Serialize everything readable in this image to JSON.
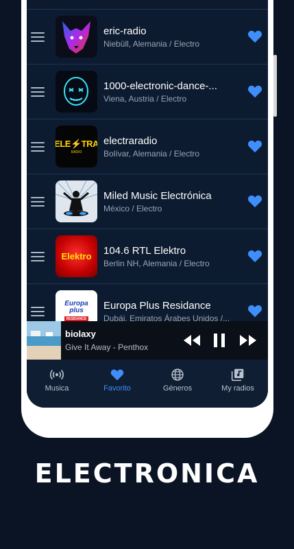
{
  "stations": [
    {
      "name": "eric-radio",
      "location": "Niebüll, Alemania / Electro",
      "logo_icon": "neon-wolf-logo"
    },
    {
      "name": "1000-electronic-dance-...",
      "location": "Viena, Austria / Electro",
      "logo_icon": "neon-mask-logo"
    },
    {
      "name": "electraradio",
      "location": "Bolívar, Alemania / Electro",
      "logo_icon": "electra-logo",
      "logo_text": "ELE⚡TRA",
      "logo_subtext": "RADIO"
    },
    {
      "name": "Miled Music Electrónica",
      "location": "México / Electro",
      "logo_icon": "dj-silhouette-logo"
    },
    {
      "name": "104.6 RTL Elektro",
      "location": "Berlin NH, Alemania / Electro",
      "logo_icon": "elektro-logo",
      "logo_text": "Elektro"
    },
    {
      "name": "Europa Plus Residance",
      "location": "Dubái, Emiratos Árabes Unidos /...",
      "logo_icon": "europa-plus-logo",
      "logo_text": "Europa plus",
      "logo_subtext": "RESIDANCE"
    }
  ],
  "player": {
    "title": "biolaxy",
    "subtitle": "Give It Away - Penthox"
  },
  "nav": [
    {
      "label": "Musica",
      "icon": "radio-waves-icon",
      "active": false
    },
    {
      "label": "Favorito",
      "icon": "heart-icon",
      "active": true
    },
    {
      "label": "Géneros",
      "icon": "globe-icon",
      "active": false
    },
    {
      "label": "My radios",
      "icon": "music-library-icon",
      "active": false
    }
  ],
  "caption": "ELECTRONICA",
  "colors": {
    "background": "#0b1424",
    "row": "#0d1b30",
    "heart": "#3f8efc",
    "active_nav": "#3f8efc"
  }
}
